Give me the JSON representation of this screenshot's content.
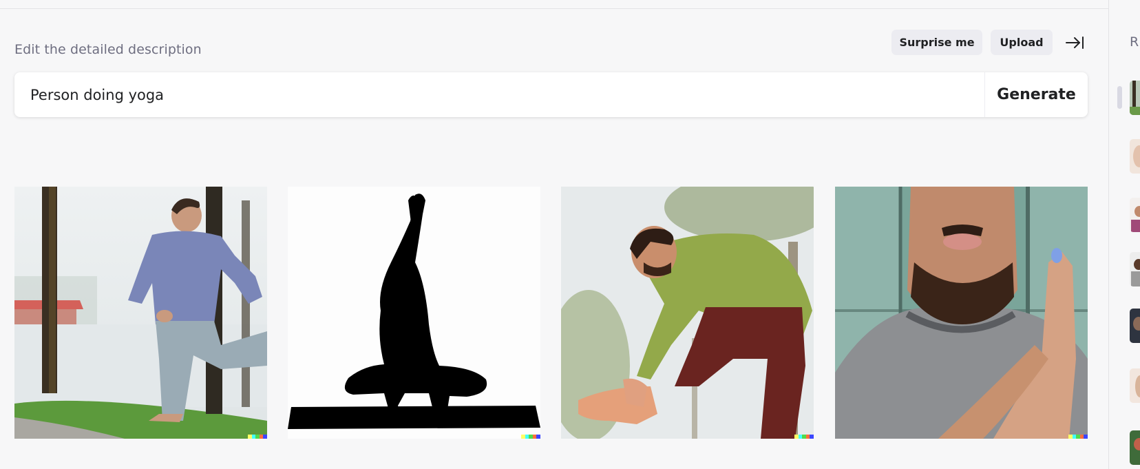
{
  "header": {
    "edit_label": "Edit the detailed description",
    "surprise_label": "Surprise me",
    "upload_label": "Upload",
    "collapse_icon": "arrow-right-to-bar-icon"
  },
  "prompt": {
    "value": "Person doing yoga",
    "generate_label": "Generate"
  },
  "results": [
    {
      "name": "result-image-1",
      "description": "man stretching outdoors among trees"
    },
    {
      "name": "result-image-2",
      "description": "black silhouette squatting yoga pose on mat"
    },
    {
      "name": "result-image-3",
      "description": "man in green shirt touching foot outdoors"
    },
    {
      "name": "result-image-4",
      "description": "close-up man with hands pressed together"
    }
  ],
  "sidebar": {
    "heading_partial": "R"
  },
  "colors": {
    "signature": [
      "#fffe66",
      "#42ffff",
      "#51da4c",
      "#ff6e3c",
      "#3c46ff"
    ]
  }
}
